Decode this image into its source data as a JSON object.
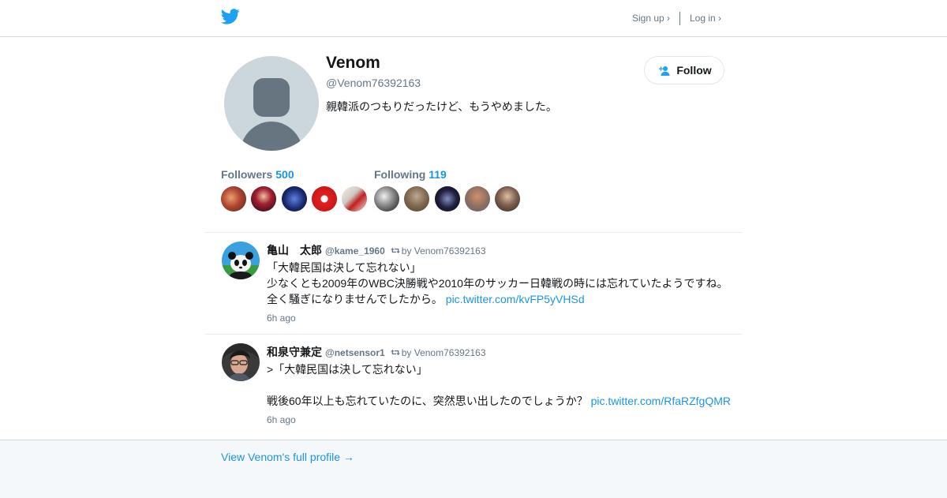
{
  "brand": {
    "icon": "twitter-bird-icon",
    "color": "#1da1f2"
  },
  "nav": {
    "signup": "Sign up ›",
    "login": "Log in ›"
  },
  "profile": {
    "name": "Venom",
    "handle": "@Venom76392163",
    "bio": "親韓派のつもりだったけど、もうやめました。",
    "follow_label": "Follow"
  },
  "stats": {
    "followers_label": "Followers",
    "followers_count": "500",
    "following_label": "Following",
    "following_count": "119"
  },
  "tweets": [
    {
      "name": "亀山　太郎",
      "handle": "@kame_1960",
      "retweet_by": "by Venom76392163",
      "text": "「大韓民国は決して忘れない」\n少なくとも2009年のWBC決勝戦や2010年のサッカー日韓戦の時には忘れていたようですね。\n全く騒ぎになりませんでしたから。 ",
      "link": "pic.twitter.com/kvFP5yVHSd",
      "time": "6h ago"
    },
    {
      "name": "和泉守兼定",
      "handle": "@netsensor1",
      "retweet_by": "by Venom76392163",
      "text": ">「大韓民国は決して忘れない」\n\n戦後60年以上も忘れていたのに、突然思い出したのでしょうか？ ",
      "link": "pic.twitter.com/RfaRZfgQMR",
      "time": "6h ago"
    }
  ],
  "footer": {
    "link": "View Venom's full profile →"
  },
  "colors": {
    "accent": "#1b95e0",
    "muted": "#657786",
    "text": "#14171a",
    "footer_bg": "#f5f8fa"
  }
}
